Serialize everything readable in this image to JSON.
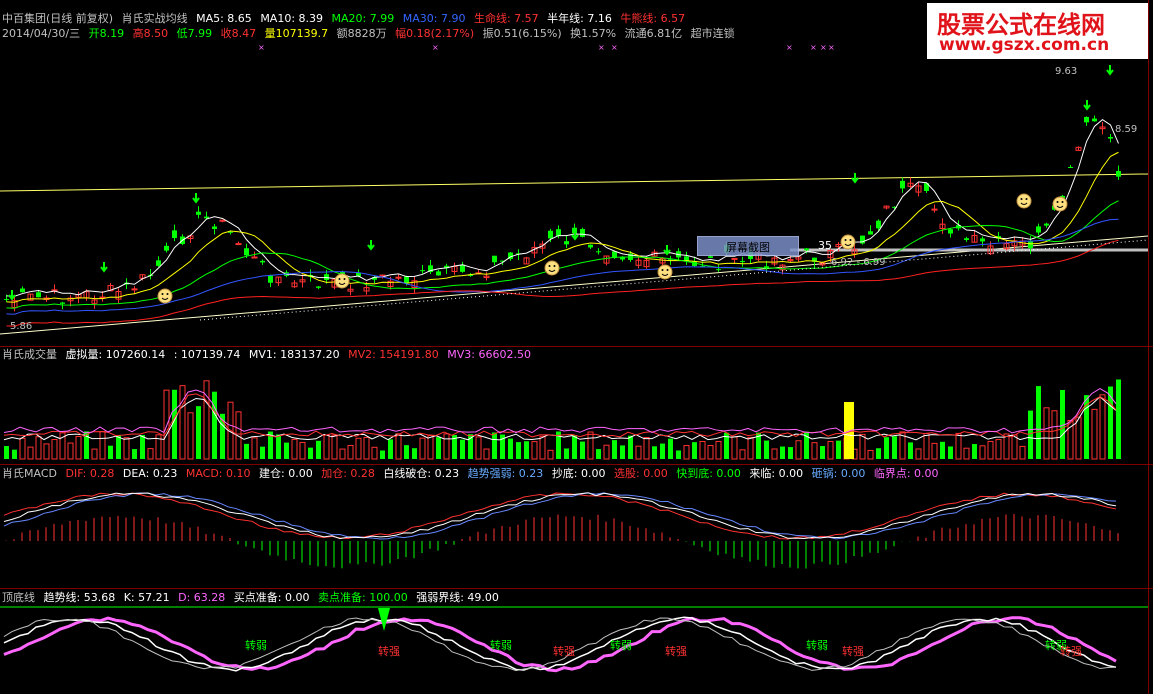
{
  "header": {
    "stock": "中百集团(日线 前复权)",
    "indicator": "肖氏实战均线",
    "ma5": "MA5: 8.65",
    "ma10": "MA10: 8.39",
    "ma20": "MA20: 7.99",
    "ma30": "MA30: 7.90",
    "life": "生命线: 7.57",
    "halfyear": "半年线: 7.16",
    "bull": "牛熊线: 6.57"
  },
  "quote": {
    "date": "2014/04/30/三",
    "open": "开8.19",
    "high": "高8.50",
    "low": "低7.99",
    "close": "收8.47",
    "vol": "量107139.7",
    "amount": "额8828万",
    "range": "幅0.18(2.17%)",
    "swing": "振0.51(6.15%)",
    "turnover": "换1.57%",
    "float": "流通6.81亿",
    "note": "超市连锁"
  },
  "price_labels": {
    "high": "9.63",
    "mid": "8.59",
    "low": "5.86",
    "shot_range": "6.92 - 6.99"
  },
  "screenshot_tag": {
    "label": "屏幕截图",
    "num": "35"
  },
  "volume": {
    "title": "肖氏成交量",
    "virtual": "虚拟量: 107260.14",
    "vol": ": 107139.74",
    "mv1": "MV1: 183137.20",
    "mv2": "MV2: 154191.80",
    "mv3": "MV3: 66602.50"
  },
  "macd": {
    "title": "肖氏MACD",
    "dif": "DIF: 0.28",
    "dea": "DEA: 0.23",
    "macd": "MACD: 0.10",
    "build": "建仓: 0.00",
    "add": "加仓: 0.28",
    "white": "白线破仓: 0.23",
    "trend": "趋势强弱: 0.23",
    "bottom": "抄底: 0.00",
    "select": "选股: 0.00",
    "fast": "快到底: 0.00",
    "come": "来临: 0.00",
    "smash": "砸锅: 0.00",
    "critical": "临界点: 0.00"
  },
  "kdj": {
    "title": "顶底线",
    "trend": "趋势线: 53.68",
    "k": "K: 57.21",
    "d": "D: 63.28",
    "buy": "买点准备: 0.00",
    "sell": "卖点准备: 100.00",
    "line": "强弱界线: 49.00",
    "weak": "转弱",
    "strong": "转强"
  },
  "watermark": {
    "line1": "股票公式在线网",
    "line2": "www.gszx.com.cn"
  },
  "colors": {
    "up": "#ff3232",
    "down": "#00ff00",
    "ma5": "#ffffff",
    "ma10": "#ffff00",
    "ma20": "#00ff00",
    "ma30": "#0000ff"
  }
}
